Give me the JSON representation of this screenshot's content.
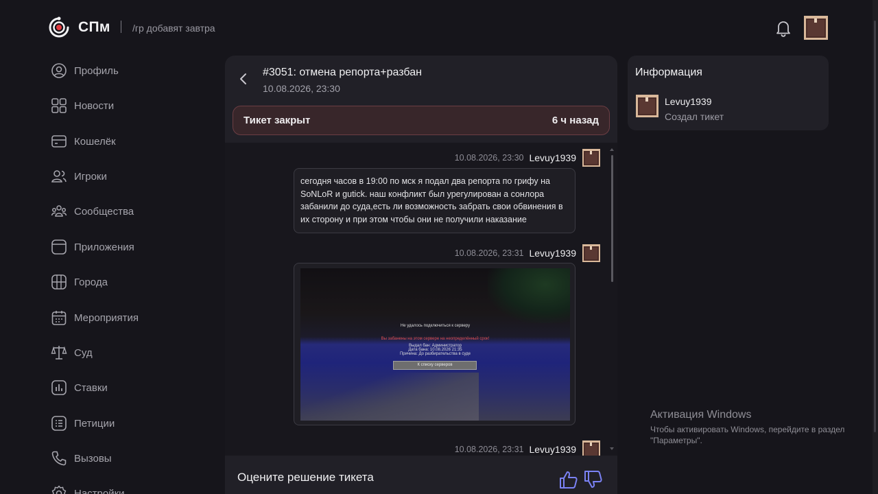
{
  "header": {
    "brand": "СПм",
    "tagline": "/гр добавят завтра"
  },
  "sidebar": {
    "items": [
      {
        "label": "Профиль",
        "icon": "user-icon"
      },
      {
        "label": "Новости",
        "icon": "grid-icon"
      },
      {
        "label": "Кошелёк",
        "icon": "wallet-icon"
      },
      {
        "label": "Игроки",
        "icon": "users-icon"
      },
      {
        "label": "Сообщества",
        "icon": "community-icon"
      },
      {
        "label": "Приложения",
        "icon": "app-icon"
      },
      {
        "label": "Города",
        "icon": "map-icon"
      },
      {
        "label": "Мероприятия",
        "icon": "calendar-icon"
      },
      {
        "label": "Суд",
        "icon": "scales-icon"
      },
      {
        "label": "Ставки",
        "icon": "chart-icon"
      },
      {
        "label": "Петиции",
        "icon": "list-icon"
      },
      {
        "label": "Вызовы",
        "icon": "phone-icon"
      },
      {
        "label": "Настройки",
        "icon": "gear-icon"
      }
    ]
  },
  "ticket": {
    "title": "#3051: отмена репорта+разбан",
    "date": "10.08.2026, 23:30",
    "status": "Тикет закрыт",
    "status_time": "6 ч назад",
    "messages": [
      {
        "time": "10.08.2026, 23:30",
        "author": "Levuy1939",
        "text": "сегодня часов в 19:00 по мск я подал два репорта по грифу на SoNLoR и gutick. наш конфликт был урегулирован а сонлора забанили до суда,есть ли возможность забрать свои обвинения в их сторону и при этом чтобы они не получили наказание"
      },
      {
        "time": "10.08.2026, 23:31",
        "author": "Levuy1939",
        "screenshot": {
          "line1": "Не удалось подключиться к серверу",
          "line2": "Вы забанены на этом сервере на неопределённый срок!",
          "line3": "Выдал бан: Администратор",
          "line4": "Дата бана: 10.08.2026 21:35",
          "line5": "Причина: До разбирательства в суде",
          "button": "К списку серверов"
        }
      },
      {
        "time": "10.08.2026, 23:31",
        "author": "Levuy1939"
      }
    ],
    "rate_label": "Оцените решение тикета"
  },
  "info": {
    "title": "Информация",
    "user": "Levuy1939",
    "role": "Создал тикет"
  },
  "watermark": {
    "title": "Активация Windows",
    "subtitle": "Чтобы активировать Windows, перейдите в раздел \"Параметры\"."
  },
  "colors": {
    "background": "#16151b",
    "panel": "#212027",
    "status_bg": "#38262a",
    "status_border": "#6c3e44",
    "logo_accent": "#e0393e",
    "thumb_accent": "#7b82f5"
  }
}
